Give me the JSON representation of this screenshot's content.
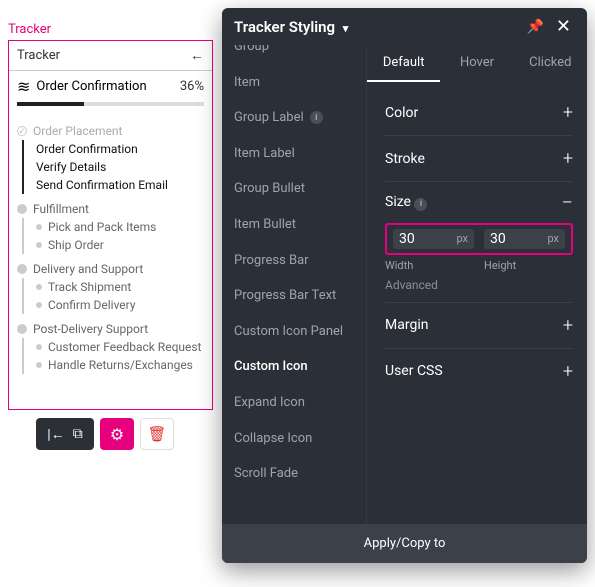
{
  "tracker": {
    "label": "Tracker",
    "header": "Tracker",
    "current": "Order Confirmation",
    "percent": "36%",
    "steps": [
      {
        "title": "Order Placement",
        "status": "done",
        "subs": [
          {
            "label": "Order Confirmation",
            "active": true
          },
          {
            "label": "Verify Details",
            "active": true
          },
          {
            "label": "Send Confirmation Email",
            "active": true
          }
        ],
        "sub_active": true
      },
      {
        "title": "Fulfillment",
        "status": "pending",
        "subs": [
          {
            "label": "Pick and Pack Items"
          },
          {
            "label": "Ship Order"
          }
        ]
      },
      {
        "title": "Delivery and Support",
        "status": "pending",
        "subs": [
          {
            "label": "Track Shipment"
          },
          {
            "label": "Confirm Delivery"
          }
        ]
      },
      {
        "title": "Post-Delivery Support",
        "status": "pending",
        "subs": [
          {
            "label": "Customer Feedback Request"
          },
          {
            "label": "Handle Returns/Exchanges"
          }
        ]
      }
    ]
  },
  "panel": {
    "title": "Tracker Styling",
    "sidebar": [
      "Group",
      "Item",
      "Group Label",
      "Item Label",
      "Group Bullet",
      "Item Bullet",
      "Progress Bar",
      "Progress Bar Text",
      "Custom Icon Panel",
      "Custom Icon",
      "Expand Icon",
      "Collapse Icon",
      "Scroll Fade"
    ],
    "sidebar_info": {
      "2": true
    },
    "selected_sidebar": 9,
    "tabs": [
      "Default",
      "Hover",
      "Clicked"
    ],
    "active_tab": 0,
    "sections": {
      "color": "Color",
      "stroke": "Stroke",
      "size": "Size",
      "margin": "Margin",
      "usercss": "User CSS"
    },
    "size": {
      "width": "30",
      "width_unit": "px",
      "width_label": "Width",
      "height": "30",
      "height_unit": "px",
      "height_label": "Height",
      "advanced": "Advanced"
    },
    "footer": "Apply/Copy to"
  }
}
